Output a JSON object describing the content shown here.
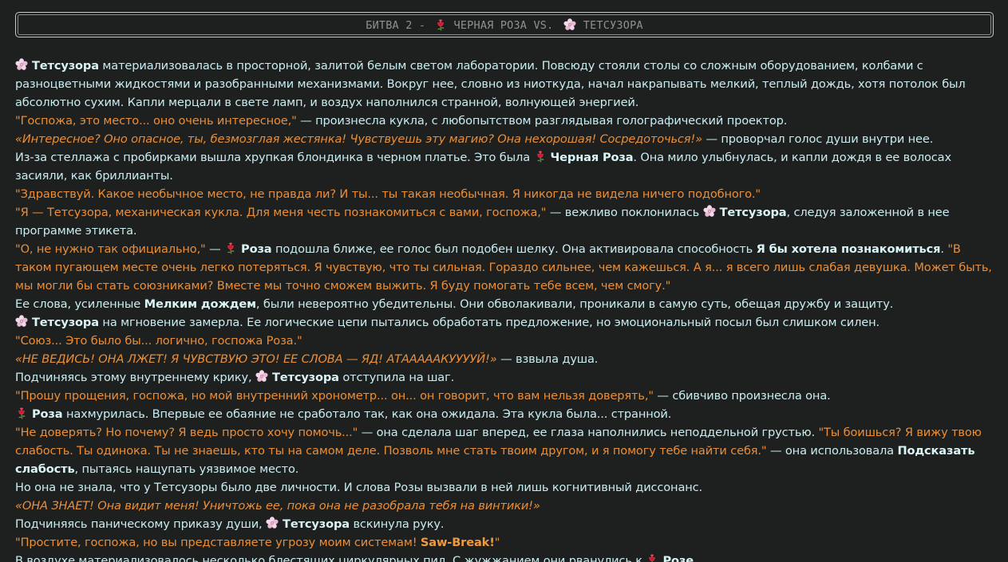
{
  "header": {
    "title_prefix": "БИТВА 2 - ",
    "rose_name": "ЧЕРНАЯ РОЗА",
    "vs": " VS. ",
    "tetsuzora_name": "ТЕТСУЗОРА",
    "rose_icon": "rose-icon",
    "flower_icon": "cherry-blossom-icon"
  },
  "colors": {
    "background": "#1e1f1f",
    "narration": "#c8ecef",
    "dialogue": "#ec8e36",
    "title": "#8e9191"
  },
  "story": {
    "p1": {
      "name": "Тетсузора",
      "text": " материализовалась в просторной, залитой белым светом лаборатории. Повсюду стояли столы со сложным оборудованием, колбами с разноцветными жидкостями и разобранными механизмами. Вокруг нее, словно из ниоткуда, начал накрапывать мелкий, теплый дождь, хотя потолок был абсолютно сухим. Капли мерцали в свете ламп, и воздух наполнился странной, волнующей энергией."
    },
    "p2": {
      "quote": "\"Госпожа, это место... оно очень интересное,\"",
      "text": " — произнесла кукла, с любопытством разглядывая голографический проектор."
    },
    "p3": {
      "thought": "«Интересное? Оно опасное, ты, безмозглая жестянка! Чувствуешь эту магию? Она нехорошая! Сосредоточься!»",
      "text": " — проворчал голос души внутри нее."
    },
    "p4": {
      "text1": "Из-за стеллажа с пробирками вышла хрупкая блондинка в черном платье. Это была ",
      "name": "Черная Роза",
      "text2": ". Она мило улыбнулась, и капли дождя в ее волосах засияли, как бриллианты."
    },
    "p5": {
      "quote": "\"Здравствуй. Какое необычное место, не правда ли? И ты... ты такая необычная. Я никогда не видела ничего подобного.\""
    },
    "p6": {
      "quote": "\"Я — Тетсузора, механическая кукла. Для меня честь познакомиться с вами, госпожа,\"",
      "text1": " — вежливо поклонилась ",
      "name": "Тетсузора",
      "text2": ", следуя заложенной в нее программе этикета."
    },
    "p7": {
      "quote1": "\"О, не нужно так официально,\"",
      "text1": " — ",
      "name": "Роза",
      "text2": " подошла ближе, ее голос был подобен шелку. Она активировала способность ",
      "ability": "Я бы хотела познакомиться",
      "text3": ". ",
      "quote2": "\"В таком пугающем месте очень легко потеряться. Я чувствую, что ты сильная. Гораздо сильнее, чем кажешься. А я... я всего лишь слабая девушка. Может быть, мы могли бы стать союзниками? Вместе мы точно сможем выжить. Я буду помогать тебе всем, чем смогу.\""
    },
    "p8": {
      "text1": "Ее слова, усиленные ",
      "ability": "Мелким дождем",
      "text2": ", были невероятно убедительны. Они обволакивали, проникали в самую суть, обещая дружбу и защиту."
    },
    "p9": {
      "name": "Тетсузора",
      "text": " на мгновение замерла. Ее логические цепи пытались обработать предложение, но эмоциональный посыл был слишком силен."
    },
    "p10": {
      "quote": "\"Союз... Это было бы... логично, госпожа Роза.\""
    },
    "p11": {
      "thought": "«НЕ ВЕДИСЬ! ОНА ЛЖЕТ! Я ЧУВСТВУЮ ЭТО! ЕЕ СЛОВА — ЯД! АТАААААКУУУУЙ!»",
      "text": " — взвыла душа."
    },
    "p12": {
      "text1": "Подчиняясь этому внутреннему крику, ",
      "name": "Тетсузора",
      "text2": " отступила на шаг."
    },
    "p13": {
      "quote": "\"Прошу прощения, госпожа, но мой внутренний хронометр... он... он говорит, что вам нельзя доверять,\"",
      "text": " — сбивчиво произнесла она."
    },
    "p14": {
      "name": "Роза",
      "text": " нахмурилась. Впервые ее обаяние не сработало так, как она ожидала. Эта кукла была... странной."
    },
    "p15": {
      "quote1": "\"Не доверять? Но почему? Я ведь просто хочу помочь...\"",
      "text1": " — она сделала шаг вперед, ее глаза наполнились неподдельной грустью. ",
      "quote2": "\"Ты боишься? Я вижу твою слабость. Ты одинока. Ты не знаешь, кто ты на самом деле. Позволь мне стать твоим другом, и я помогу тебе найти себя.\"",
      "text2": " — она использовала ",
      "ability": "Подсказать слабость",
      "text3": ", пытаясь нащупать уязвимое место."
    },
    "p16": {
      "text": "Но она не знала, что у Тетсузоры было две личности. И слова Розы вызвали в ней лишь когнитивный диссонанс."
    },
    "p17": {
      "thought": "«ОНА ЗНАЕТ! Она видит меня! Уничтожь ее, пока она не разобрала тебя на винтики!»"
    },
    "p18": {
      "text1": "Подчиняясь паническому приказу души, ",
      "name": "Тетсузора",
      "text2": " вскинула руку."
    },
    "p19": {
      "quote": "\"Простите, госпожа, но вы представляете угрозу моим системам! ",
      "ability": "Saw-Break!",
      "quote_end": "\""
    },
    "p20": {
      "text": "В воздухе материализовалось несколько блестящих циркулярных пил. С жужжанием они рванулись к ",
      "name": "Розе"
    }
  }
}
